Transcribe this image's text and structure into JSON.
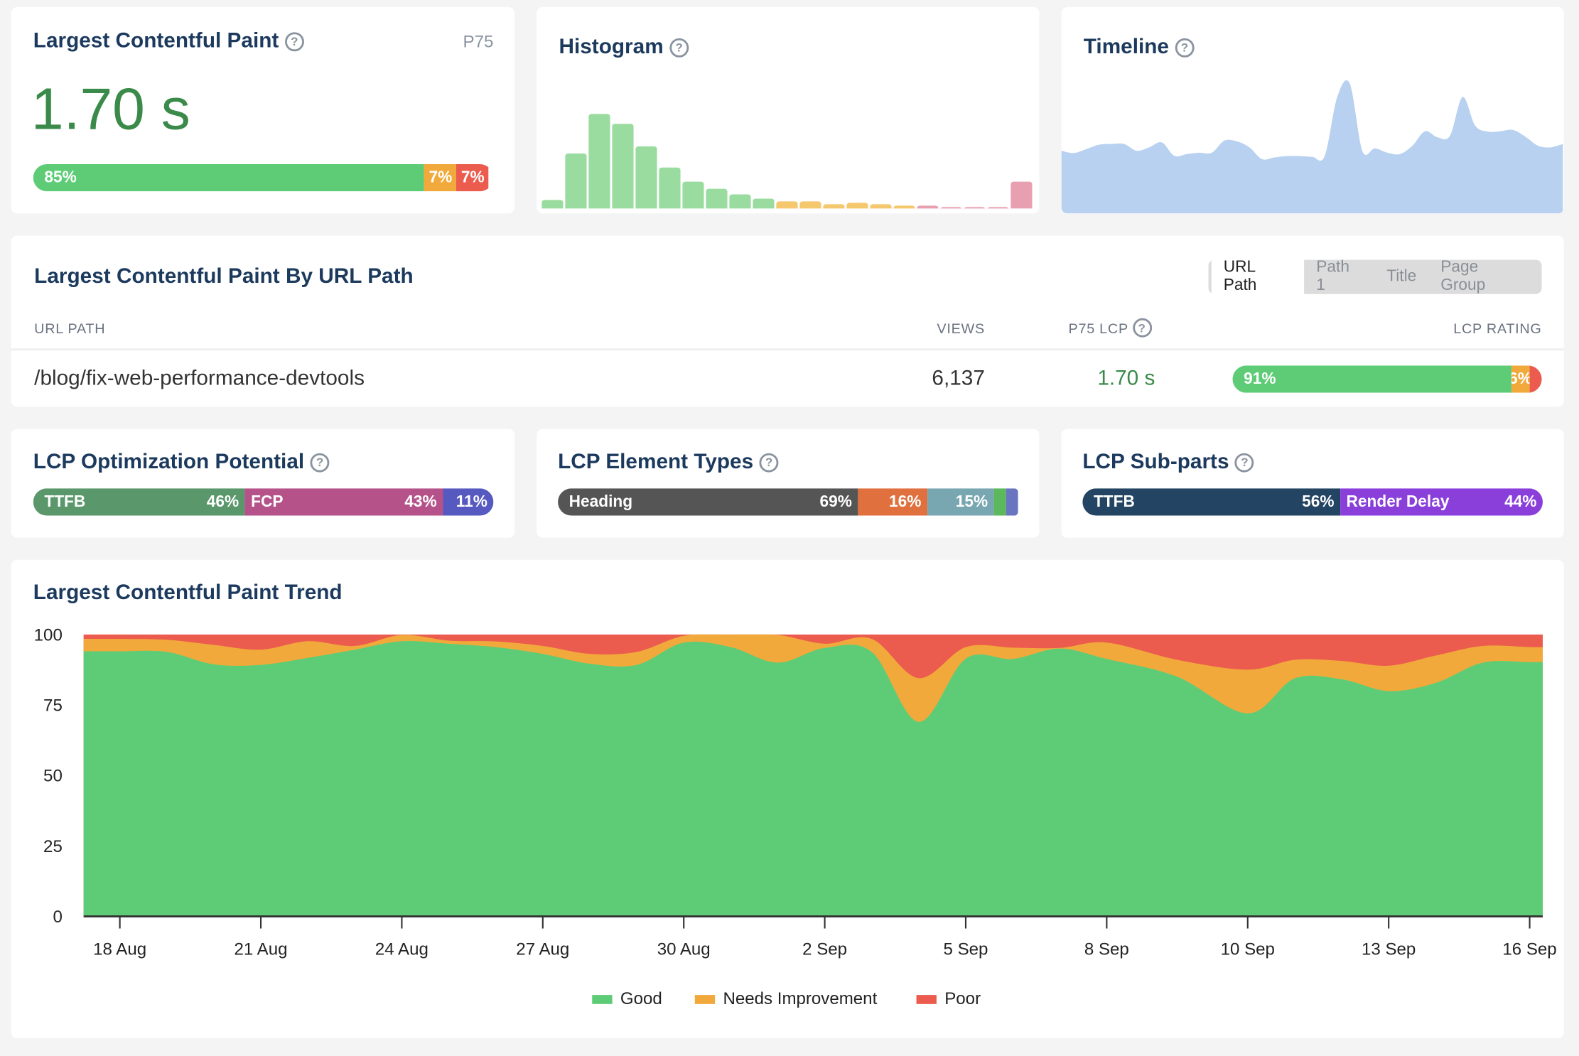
{
  "colors": {
    "good": "#5ecc76",
    "needs_improvement": "#f2a93b",
    "poor": "#eb5c4f",
    "title": "#1c3a5e"
  },
  "lcp_card": {
    "title": "Largest Contentful Paint",
    "percentile": "P75",
    "value": "1.70 s",
    "distribution": [
      {
        "label": "85%",
        "pct": 85
      },
      {
        "label": "7%",
        "pct": 7
      },
      {
        "label": "7%",
        "pct": 7
      }
    ]
  },
  "histogram": {
    "title": "Histogram",
    "bars": [
      {
        "v": 6,
        "rating": "good"
      },
      {
        "v": 39,
        "rating": "good"
      },
      {
        "v": 67,
        "rating": "good"
      },
      {
        "v": 60,
        "rating": "good"
      },
      {
        "v": 44,
        "rating": "good"
      },
      {
        "v": 29,
        "rating": "good"
      },
      {
        "v": 19,
        "rating": "good"
      },
      {
        "v": 14,
        "rating": "good"
      },
      {
        "v": 10,
        "rating": "good"
      },
      {
        "v": 7,
        "rating": "good"
      },
      {
        "v": 5,
        "rating": "needs_improvement"
      },
      {
        "v": 5,
        "rating": "needs_improvement"
      },
      {
        "v": 3,
        "rating": "needs_improvement"
      },
      {
        "v": 4,
        "rating": "needs_improvement"
      },
      {
        "v": 3,
        "rating": "needs_improvement"
      },
      {
        "v": 2,
        "rating": "needs_improvement"
      },
      {
        "v": 2,
        "rating": "poor"
      },
      {
        "v": 1,
        "rating": "poor"
      },
      {
        "v": 1,
        "rating": "poor"
      },
      {
        "v": 1,
        "rating": "poor"
      },
      {
        "v": 19,
        "rating": "poor"
      }
    ],
    "colors": {
      "good": "#9adc9f",
      "needs_improvement": "#f5c86e",
      "poor": "#e8a0b0"
    }
  },
  "timeline": {
    "title": "Timeline",
    "color": "#b8d1f0",
    "values": [
      172,
      165,
      177,
      190,
      192,
      192,
      172,
      182,
      197,
      157,
      162,
      166,
      166,
      202,
      200,
      182,
      147,
      152,
      156,
      156,
      154,
      156,
      332,
      372,
      172,
      179,
      166,
      162,
      187,
      230,
      212,
      217,
      332,
      247,
      229,
      230,
      234,
      214,
      187,
      182,
      192
    ]
  },
  "by_path": {
    "title": "Largest Contentful Paint By URL Path",
    "tabs": [
      {
        "label": "URL Path",
        "active": true
      },
      {
        "label": "Path 1"
      },
      {
        "label": "Title"
      },
      {
        "label": "Page Group"
      }
    ],
    "columns": {
      "url": "URL PATH",
      "views": "VIEWS",
      "p75": "P75 LCP",
      "rating": "LCP RATING"
    },
    "rows": [
      {
        "url": "/blog/fix-web-performance-devtools",
        "views": "6,137",
        "p75": "1.70 s",
        "rating": [
          {
            "label": "91%",
            "pct": 91
          },
          {
            "label": "6%",
            "pct": 6
          },
          {
            "label": "",
            "pct": 3
          }
        ]
      }
    ]
  },
  "optimization": {
    "title": "LCP Optimization Potential",
    "segments": [
      {
        "name": "TTFB",
        "label": "46%",
        "pct": 46,
        "color": "#5a976b"
      },
      {
        "name": "FCP",
        "label": "43%",
        "pct": 43,
        "color": "#b45289"
      },
      {
        "name": "",
        "label": "11%",
        "pct": 11,
        "color": "#5559c0"
      }
    ]
  },
  "element_types": {
    "title": "LCP Element Types",
    "segments": [
      {
        "name": "Heading",
        "label": "69%",
        "pct": 67.4,
        "color": "#555555"
      },
      {
        "name": "",
        "label": "16%",
        "pct": 15.5,
        "color": "#e0703e"
      },
      {
        "name": "",
        "label": "15%",
        "pct": 14.9,
        "color": "#78a6b1"
      },
      {
        "name": "",
        "label": "",
        "pct": 1.1,
        "color": "#5cb85c"
      },
      {
        "name": "",
        "label": "",
        "pct": 1.1,
        "color": "#6a75c0"
      }
    ]
  },
  "subparts": {
    "title": "LCP Sub-parts",
    "segments": [
      {
        "name": "TTFB",
        "label": "56%",
        "pct": 56,
        "color": "#244463"
      },
      {
        "name": "Render Delay",
        "label": "44%",
        "pct": 44,
        "color": "#8a3fdb"
      }
    ]
  },
  "chart_data": {
    "type": "area",
    "title": "Largest Contentful Paint Trend",
    "stacked": true,
    "ylim": [
      0,
      100
    ],
    "yticks": [
      "0",
      "25",
      "50",
      "75",
      "100"
    ],
    "xticks": [
      "18 Aug",
      "21 Aug",
      "24 Aug",
      "27 Aug",
      "30 Aug",
      "2 Sep",
      "5 Sep",
      "8 Sep",
      "10 Sep",
      "13 Sep",
      "16 Sep"
    ],
    "x": [
      "18 Aug",
      "19 Aug",
      "20 Aug",
      "21 Aug",
      "22 Aug",
      "23 Aug",
      "24 Aug",
      "25 Aug",
      "26 Aug",
      "27 Aug",
      "28 Aug",
      "29 Aug",
      "30 Aug",
      "31 Aug",
      "1 Sep",
      "2 Sep",
      "3 Sep",
      "4 Sep",
      "5 Sep",
      "6 Sep",
      "7 Sep",
      "8 Sep",
      "9 Sep",
      "10 Sep",
      "11 Sep",
      "12 Sep",
      "13 Sep",
      "14 Sep",
      "15 Sep",
      "16 Sep"
    ],
    "series": [
      {
        "name": "Good",
        "color": "#5ecc76",
        "values": [
          94,
          93.8,
          89.4,
          89.2,
          91.7,
          94.6,
          97.6,
          96.7,
          95.5,
          93.1,
          89.6,
          89.2,
          97.1,
          95.5,
          90,
          95.2,
          93.8,
          69,
          91.4,
          91.3,
          95,
          91.3,
          85,
          72,
          84.4,
          84.1,
          79.9,
          82.8,
          90,
          90.2
        ]
      },
      {
        "name": "Needs Improvement",
        "color": "#f2a93b",
        "values": [
          4.4,
          4.3,
          6.9,
          5.4,
          5.9,
          1.3,
          2.2,
          1.1,
          2,
          2.8,
          3.5,
          4.6,
          2.4,
          4.5,
          9.8,
          1.5,
          4.6,
          15.5,
          4.1,
          4,
          0.2,
          5.8,
          6,
          15.5,
          6.6,
          6.5,
          9,
          9.7,
          5.9,
          5.3
        ]
      },
      {
        "name": "Poor",
        "color": "#eb5c4f",
        "values": [
          1.6,
          1.9,
          3.7,
          5.4,
          2.4,
          4.1,
          0.2,
          2.2,
          2.5,
          4.1,
          6.9,
          6.2,
          0.5,
          0,
          0.2,
          3.3,
          1.6,
          15.5,
          4.5,
          4.7,
          4.8,
          2.9,
          9,
          12.5,
          9,
          9.4,
          11.1,
          7.5,
          4.1,
          4.5
        ]
      }
    ],
    "legend": "bottom-center",
    "grid": false
  }
}
